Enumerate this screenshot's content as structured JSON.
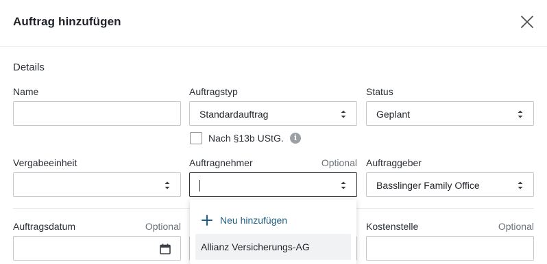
{
  "dialog": {
    "title": "Auftrag hinzufügen",
    "section_title": "Details"
  },
  "fields": {
    "name": {
      "label": "Name",
      "value": ""
    },
    "auftragstyp": {
      "label": "Auftragstyp",
      "value": "Standardauftrag"
    },
    "status": {
      "label": "Status",
      "value": "Geplant"
    },
    "nach13b": {
      "label": "Nach §13b UStG.",
      "checked": false
    },
    "vergabeeinheit": {
      "label": "Vergabeeinheit",
      "value": ""
    },
    "auftragnehmer": {
      "label": "Auftragnehmer",
      "optional": "Optional",
      "value": ""
    },
    "auftraggeber": {
      "label": "Auftraggeber",
      "value": "Basslinger Family Office"
    },
    "auftragsdatum": {
      "label": "Auftragsdatum",
      "optional": "Optional",
      "value": ""
    },
    "kostenstelle": {
      "label": "Kostenstelle",
      "optional": "Optional",
      "value": ""
    }
  },
  "dropdown": {
    "add_label": "Neu hinzufügen",
    "options": [
      "Allianz Versicherungs-AG"
    ]
  },
  "colors": {
    "accent": "#1f5f86",
    "border": "#c4c8cd",
    "highlight": "#f1f2f3"
  },
  "icons": {
    "close": "close-icon",
    "select": "updown-chevron-icon",
    "calendar": "calendar-icon",
    "info": "info-icon",
    "add": "plus-icon"
  }
}
